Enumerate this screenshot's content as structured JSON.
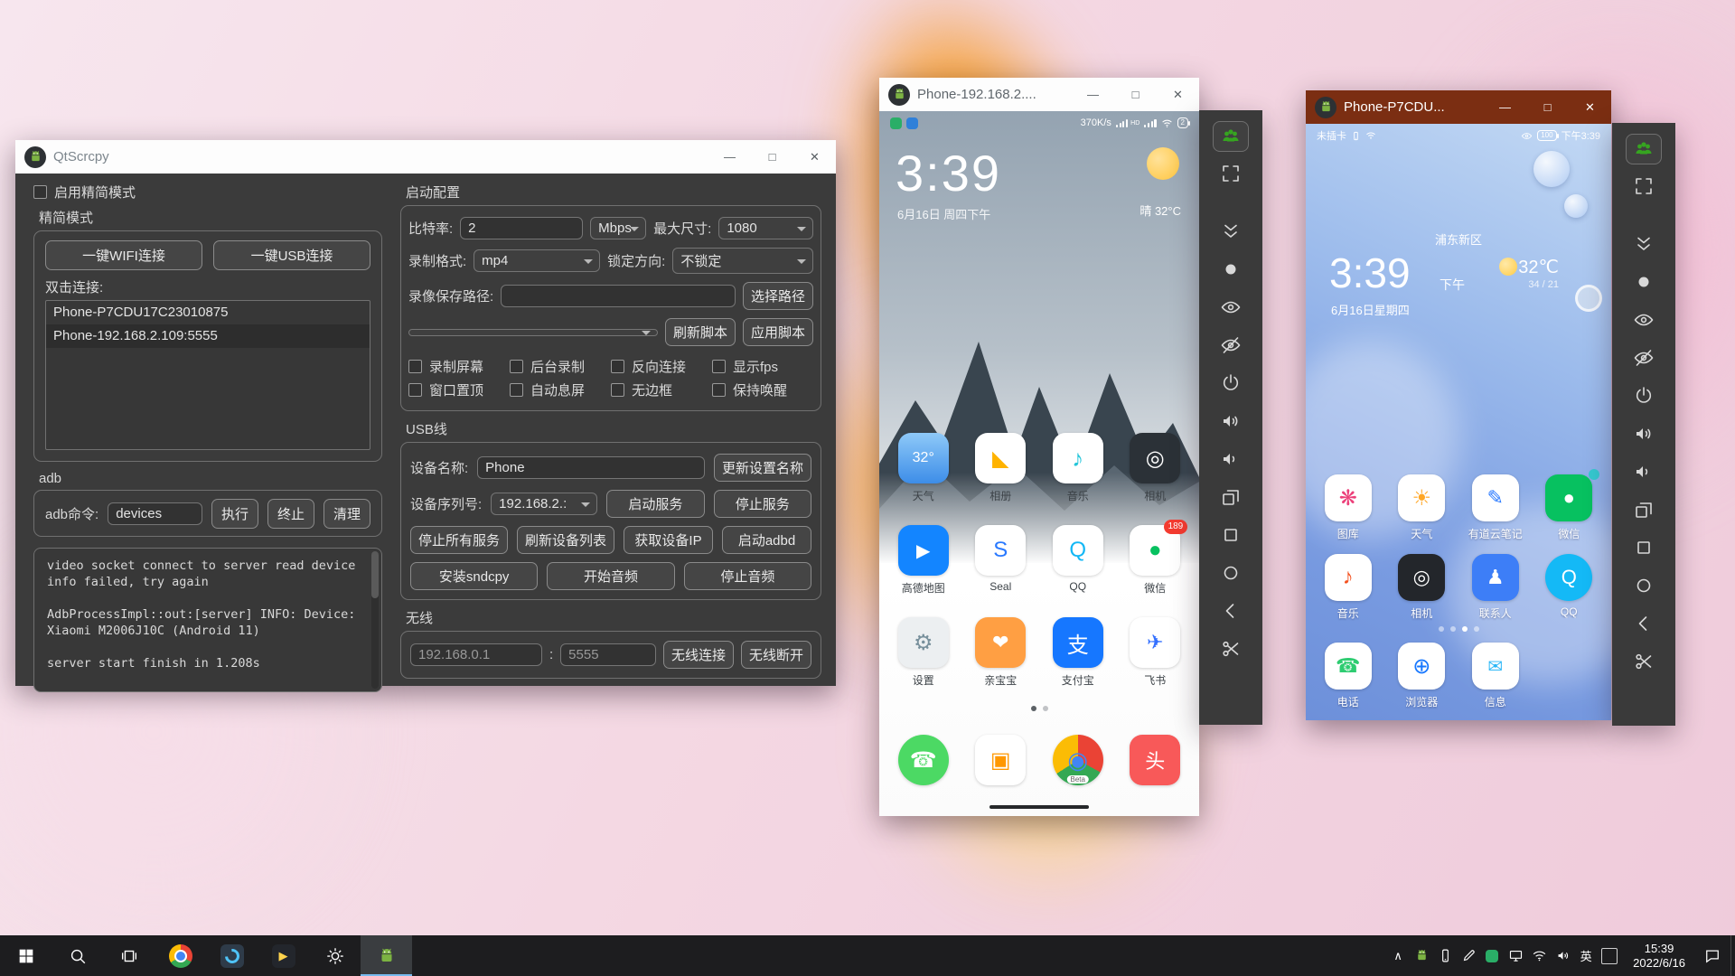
{
  "window_controls": {
    "minimize": "—",
    "maximize": "□",
    "close": "✕"
  },
  "qtscrcpy": {
    "title": "QtScrcpy",
    "enable_simple_mode": "启用精简模式",
    "simple_group_title": "精简模式",
    "wifi_connect_btn": "一键WIFI连接",
    "usb_connect_btn": "一键USB连接",
    "double_click_label": "双击连接:",
    "device_list": [
      "Phone-P7CDU17C23010875",
      "Phone-192.168.2.109:5555"
    ],
    "selected_device_index": 1,
    "adb_section_label": "adb",
    "adb_cmd_label": "adb命令:",
    "adb_cmd_value": "devices",
    "exec_btn": "执行",
    "terminate_btn": "终止",
    "clear_btn": "清理",
    "log_lines": [
      "video socket connect to server read device",
      "info failed, try again",
      "",
      "AdbProcessImpl::out:[server] INFO: Device:",
      "Xiaomi M2006J10C (Android 11)",
      "",
      "server start finish in 1.208s"
    ],
    "launch_config": {
      "title": "启动配置",
      "bitrate_label": "比特率:",
      "bitrate_value": "2",
      "bitrate_unit": "Mbps",
      "max_size_label": "最大尺寸:",
      "max_size_value": "1080",
      "record_format_label": "录制格式:",
      "record_format_value": "mp4",
      "lock_orientation_label": "锁定方向:",
      "lock_orientation_value": "不锁定",
      "save_path_label": "录像保存路径:",
      "save_path_value": "",
      "choose_path_btn": "选择路径",
      "refresh_script_btn": "刷新脚本",
      "apply_script_btn": "应用脚本",
      "options": [
        "录制屏幕",
        "后台录制",
        "反向连接",
        "显示fps",
        "窗口置顶",
        "自动息屏",
        "无边框",
        "保持唤醒"
      ]
    },
    "usb_section": {
      "title": "USB线",
      "device_name_label": "设备名称:",
      "device_name_value": "Phone",
      "update_name_btn": "更新设置名称",
      "serial_label": "设备序列号:",
      "serial_value": "192.168.2.:",
      "start_service_btn": "启动服务",
      "stop_service_btn": "停止服务",
      "stop_all_btn": "停止所有服务",
      "refresh_list_btn": "刷新设备列表",
      "get_ip_btn": "获取设备IP",
      "start_adbd_btn": "启动adbd",
      "install_sndcpy_btn": "安装sndcpy",
      "start_audio_btn": "开始音频",
      "stop_audio_btn": "停止音频"
    },
    "wireless_section": {
      "title": "无线",
      "ip_value": "192.168.0.1",
      "separator": ":",
      "port_value": "5555",
      "connect_btn": "无线连接",
      "disconnect_btn": "无线断开"
    }
  },
  "toolbar": {
    "icons": [
      {
        "name": "group-control"
      },
      {
        "name": "fullscreen"
      },
      {
        "name": "expand-notifications"
      },
      {
        "name": "screenshot"
      },
      {
        "name": "screen-on"
      },
      {
        "name": "screen-off"
      },
      {
        "name": "power"
      },
      {
        "name": "volume-up"
      },
      {
        "name": "volume-down"
      },
      {
        "name": "app-switch"
      },
      {
        "name": "menu"
      },
      {
        "name": "home"
      },
      {
        "name": "back"
      },
      {
        "name": "touch-cut"
      }
    ]
  },
  "miui_phone": {
    "window_title": "Phone-192.168.2....",
    "status": {
      "net_speed": "370K/s",
      "hd_label": "HD",
      "battery_level": "2"
    },
    "clock": "3:39",
    "date": "6月16日 周四下午",
    "weather": "晴 32°C",
    "apps": [
      {
        "label": "天气",
        "bg": "linear-gradient(180deg,#8ec9f8,#3d8de8)",
        "glyph": "32°",
        "color": "#ffffff",
        "size": 16
      },
      {
        "label": "相册",
        "bg": "#ffffff",
        "glyph": "◣",
        "color": "#ffb300",
        "size": 24
      },
      {
        "label": "音乐",
        "bg": "#ffffff",
        "glyph": "♪",
        "color": "#26c6da",
        "size": 26
      },
      {
        "label": "相机",
        "bg": "#2b3137",
        "glyph": "◎",
        "color": "#ffffff",
        "size": 24
      },
      {
        "label": "高德地图",
        "bg": "#1385ff",
        "glyph": "▶",
        "color": "#ffffff",
        "size": 20
      },
      {
        "label": "Seal",
        "bg": "#ffffff",
        "glyph": "S",
        "color": "#2979ff",
        "size": 24
      },
      {
        "label": "QQ",
        "bg": "#ffffff",
        "glyph": "Q",
        "color": "#12b7f5",
        "size": 24
      },
      {
        "label": "微信",
        "bg": "#ffffff",
        "glyph": "●",
        "color": "#07c160",
        "size": 24,
        "badge": "189"
      },
      {
        "label": "设置",
        "bg": "#eceff1",
        "glyph": "⚙",
        "color": "#78909c",
        "size": 24
      },
      {
        "label": "亲宝宝",
        "bg": "#ff9f43",
        "glyph": "❤",
        "color": "#ffffff",
        "size": 22
      },
      {
        "label": "支付宝",
        "bg": "#1677ff",
        "glyph": "支",
        "color": "#ffffff",
        "size": 24
      },
      {
        "label": "飞书",
        "bg": "#ffffff",
        "glyph": "✈",
        "color": "#3370ff",
        "size": 22
      }
    ],
    "dock": [
      {
        "label": "",
        "bg": "#4cd964",
        "glyph": "☎",
        "color": "#ffffff",
        "round": true,
        "size": 24
      },
      {
        "label": "",
        "bg": "#ffffff",
        "glyph": "▣",
        "color": "#ff9800",
        "size": 24
      },
      {
        "label": "",
        "bg": "conic-gradient(#ea4335 0 33%,#34a853 33% 66%,#fbbc05 66% 100%)",
        "glyph": "◉",
        "color": "#4285f4",
        "round": true,
        "size": 26,
        "sub": "Beta"
      },
      {
        "label": "",
        "bg": "#f85959",
        "glyph": "头",
        "color": "#ffffff",
        "size": 22
      }
    ],
    "page_dots": {
      "count": 2,
      "active": 0
    }
  },
  "huawei_phone": {
    "window_title": "Phone-P7CDU...",
    "status": {
      "left_text": "未插卡",
      "battery_level": "100",
      "time": "下午3:39"
    },
    "location": "浦东新区",
    "clock": "3:39",
    "ampm": "下午",
    "temp": "32℃",
    "hi_lo": "34 / 21",
    "date": "6月16日星期四",
    "apps": [
      {
        "label": "图库",
        "bg": "#ffffff",
        "glyph": "❋",
        "color": "#ec407a",
        "size": 24
      },
      {
        "label": "天气",
        "bg": "#ffffff",
        "glyph": "☀",
        "color": "#ffa726",
        "size": 24
      },
      {
        "label": "有道云笔记",
        "bg": "#ffffff",
        "glyph": "✎",
        "color": "#2979ff",
        "size": 22
      },
      {
        "label": "微信",
        "bg": "#07c160",
        "glyph": "●",
        "color": "#ffffff",
        "size": 22,
        "badge": "",
        "badge_bg": "#35c8d0"
      },
      {
        "label": "音乐",
        "bg": "#ffffff",
        "glyph": "♪",
        "color": "#f4511e",
        "size": 24
      },
      {
        "label": "相机",
        "bg": "#23262b",
        "glyph": "◎",
        "color": "#ffffff",
        "size": 22
      },
      {
        "label": "联系人",
        "bg": "#3d7ef7",
        "glyph": "♟",
        "color": "#ffffff",
        "size": 22
      },
      {
        "label": "QQ",
        "bg": "#14b9f6",
        "glyph": "Q",
        "color": "#ffffff",
        "round": true,
        "size": 22
      }
    ],
    "dock": [
      {
        "label": "电话",
        "bg": "#ffffff",
        "glyph": "☎",
        "color": "#2ecc71",
        "size": 22
      },
      {
        "label": "浏览器",
        "bg": "#ffffff",
        "glyph": "⊕",
        "color": "#1677ff",
        "size": 24
      },
      {
        "label": "信息",
        "bg": "#ffffff",
        "glyph": "✉",
        "color": "#29b6f6",
        "size": 20
      }
    ],
    "page_dots": {
      "count": 4,
      "active": 2
    }
  },
  "taskbar": {
    "apps": [
      {
        "name": "start",
        "icon": "winlogo"
      },
      {
        "name": "search",
        "icon": "search"
      },
      {
        "name": "task-view",
        "icon": "taskview"
      },
      {
        "name": "chrome",
        "icon": "chrome-css"
      },
      {
        "name": "media-app",
        "icon": "blueapp-css"
      },
      {
        "name": "player",
        "icon": "player-css"
      },
      {
        "name": "settings",
        "icon": "gear"
      },
      {
        "name": "qtscrcpy",
        "icon": "droid",
        "active": true
      }
    ],
    "tray": [
      {
        "name": "hidden-icons-chevron",
        "text": "∧"
      },
      {
        "name": "android-tray",
        "svg": "droid"
      },
      {
        "name": "phone-tray",
        "svg": "phone"
      },
      {
        "name": "pen-tray",
        "svg": "pen"
      },
      {
        "name": "wechat-tray",
        "chip": "#2aae67"
      },
      {
        "name": "display-tray",
        "svg": "display"
      },
      {
        "name": "network-tray",
        "svg": "wifi"
      },
      {
        "name": "volume-tray",
        "svg": "volume"
      },
      {
        "name": "language-indicator",
        "text": "英"
      },
      {
        "name": "ime-indicator",
        "text": "",
        "box": true
      }
    ],
    "time": "15:39",
    "date": "2022/6/16"
  }
}
